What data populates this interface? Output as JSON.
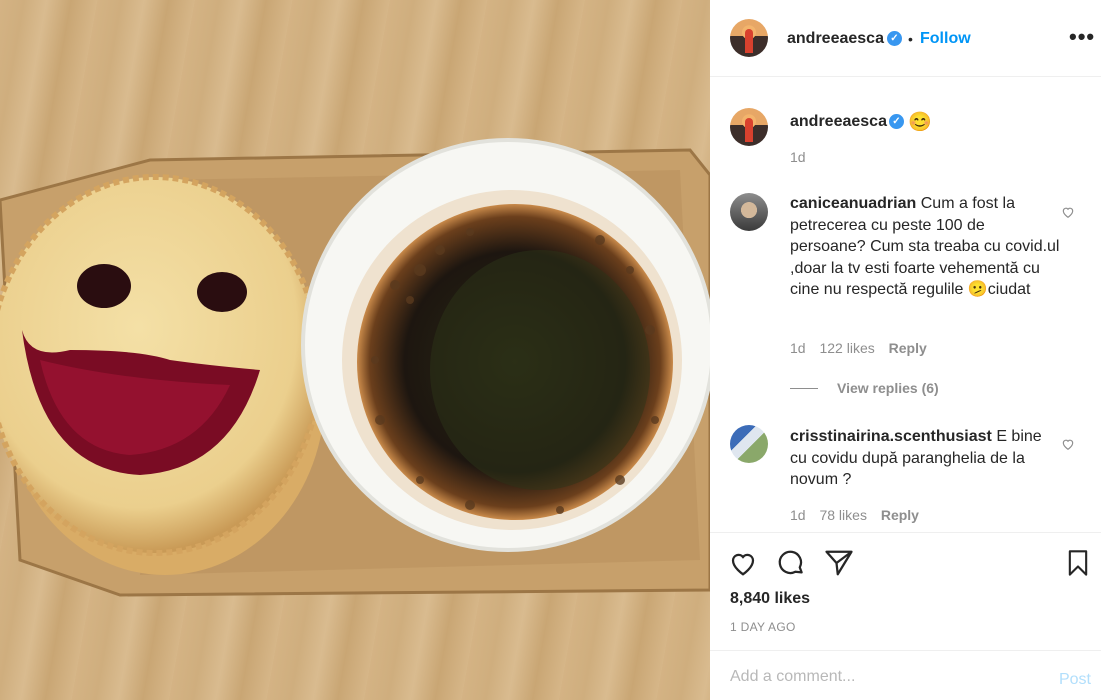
{
  "post": {
    "author": "andreeaesca",
    "follow_label": "Follow",
    "separator": "•",
    "more_label": "•••",
    "caption_emoji": "😊",
    "caption_time": "1d"
  },
  "comments": [
    {
      "user": "caniceanuadrian",
      "text": "Cum a fost la petrecerea cu peste 100 de persoane? Cum sta treaba cu covid.ul ,doar la tv esti foarte vehementă cu cine nu respectă regulile 🫤ciudat",
      "time": "1d",
      "likes": "122 likes",
      "reply": "Reply",
      "view_replies": "View replies (6)"
    },
    {
      "user": "crisstinairina.scenthusiast",
      "text": "E bine cu covidu după paranghelia de la novum ?",
      "time": "1d",
      "likes": "78 likes",
      "reply": "Reply"
    }
  ],
  "actions": {
    "likes": "8,840 likes",
    "date": "1 DAY AGO"
  },
  "comment_box": {
    "placeholder": "Add a comment...",
    "post_label": "Post"
  },
  "icons": [
    "heart-icon",
    "comment-icon",
    "share-icon",
    "bookmark-icon",
    "verified-icon"
  ],
  "colors": {
    "link": "#0095f6",
    "verified": "#3897f0",
    "muted": "#8e8e8e"
  }
}
